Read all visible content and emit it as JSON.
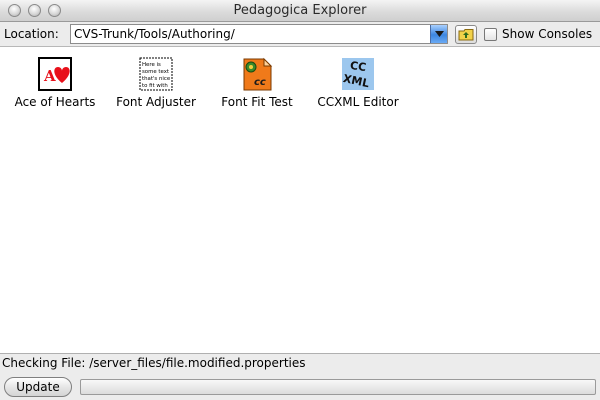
{
  "window": {
    "title": "Pedagogica Explorer"
  },
  "toolbar": {
    "location_label": "Location:",
    "location_value": "CVS-Trunk/Tools/Authoring/",
    "show_consoles_label": "Show Consoles",
    "show_consoles_checked": false
  },
  "items": [
    {
      "label": "Ace of Hearts",
      "icon": "ace-of-hearts-icon"
    },
    {
      "label": "Font Adjuster",
      "icon": "font-adjuster-icon",
      "icon_text": [
        "Here is",
        "some text",
        "that's nice",
        "to fit with"
      ]
    },
    {
      "label": "Font Fit Test",
      "icon": "font-fit-test-icon",
      "icon_text": "cc"
    },
    {
      "label": "CCXML Editor",
      "icon": "ccxml-editor-icon",
      "icon_text": [
        "CC",
        "XML"
      ]
    }
  ],
  "status": {
    "text": "Checking File: /server_files/file.modified.properties",
    "update_label": "Update",
    "progress": 0
  },
  "colors": {
    "accent": "#3c86e0",
    "heart": "#e8101a"
  }
}
